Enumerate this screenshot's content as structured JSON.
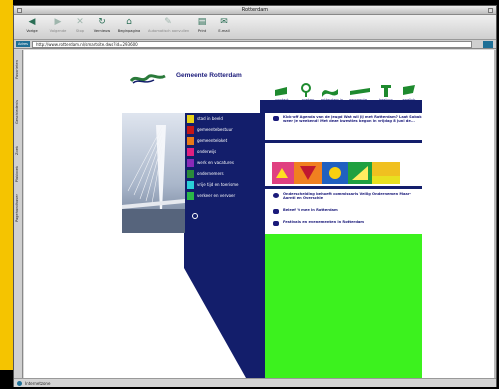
{
  "browser": {
    "window_title": "Rotterdam",
    "toolbar": [
      {
        "name": "back",
        "label": "Vorige",
        "icon": "back-arrow-icon",
        "enabled": true
      },
      {
        "name": "forward",
        "label": "Volgende",
        "icon": "forward-arrow-icon",
        "enabled": false
      },
      {
        "name": "stop",
        "label": "Stop",
        "icon": "stop-icon",
        "enabled": false
      },
      {
        "name": "refresh",
        "label": "Vernieuw",
        "icon": "refresh-icon",
        "enabled": true
      },
      {
        "name": "home",
        "label": "Beginpagina",
        "icon": "home-icon",
        "enabled": true
      },
      {
        "name": "autofill",
        "label": "Automatisch aanvullen",
        "icon": "pen-icon",
        "enabled": false
      },
      {
        "name": "print",
        "label": "Print",
        "icon": "printer-icon",
        "enabled": true
      },
      {
        "name": "email",
        "label": "E-mail",
        "icon": "mail-icon",
        "enabled": true
      }
    ],
    "address_label": "Adres",
    "address_url": "http://www.rotterdam.nl/smartsite.dws?id=293600",
    "side_tabs": [
      "Favorieten",
      "Geschiedenis",
      "Zoek",
      "Plakboek",
      "Pagehandhaver"
    ],
    "status_text": "Internetzone",
    "accent_color": "#1e6f96"
  },
  "page": {
    "site_title": "Gemeente Rotterdam",
    "brand_color": "#131e6b",
    "highlight_color": "#3cf21e",
    "top_nav": [
      {
        "label": "contact",
        "icon": "flag-icon"
      },
      {
        "label": "zoeken",
        "icon": "magnifier-icon"
      },
      {
        "label": "rotterdam in kaart",
        "icon": "wave-flag-icon"
      },
      {
        "label": "gemeente van A-Z",
        "icon": "banner-flag-icon"
      },
      {
        "label": "bestuur",
        "icon": "pillar-icon"
      },
      {
        "label": "english",
        "icon": "flag-icon"
      }
    ],
    "menu": [
      {
        "label": "stad in beeld",
        "color": "#e8d21a"
      },
      {
        "label": "gemeentebestuur",
        "color": "#c41818"
      },
      {
        "label": "gemeenteloket",
        "color": "#e87a18"
      },
      {
        "label": "onderwijs",
        "color": "#e02080"
      },
      {
        "label": "werk en vacatures",
        "color": "#8a2ab8"
      },
      {
        "label": "ondernemers",
        "color": "#2a8a3a"
      },
      {
        "label": "vrije tijd en toerisme",
        "color": "#2ad0d8"
      },
      {
        "label": "verkeer en vervoer",
        "color": "#2ab848"
      }
    ],
    "news": [
      {
        "text": "Kick-off Agenda van de jeugd Wat wil jij met Rotterdam? Laat Sobak weer je weekend! Met deze kwesties begon in vrijdag 8 juni de..."
      },
      {
        "text": "Onderscheiding behoeft commissaris Veilig Ondernemen Maar-Aarntl en Overschie"
      },
      {
        "text": "Beleef 't mee in Rotterdam"
      },
      {
        "text": "Festivals en evenementen in Rotterdam"
      }
    ]
  }
}
